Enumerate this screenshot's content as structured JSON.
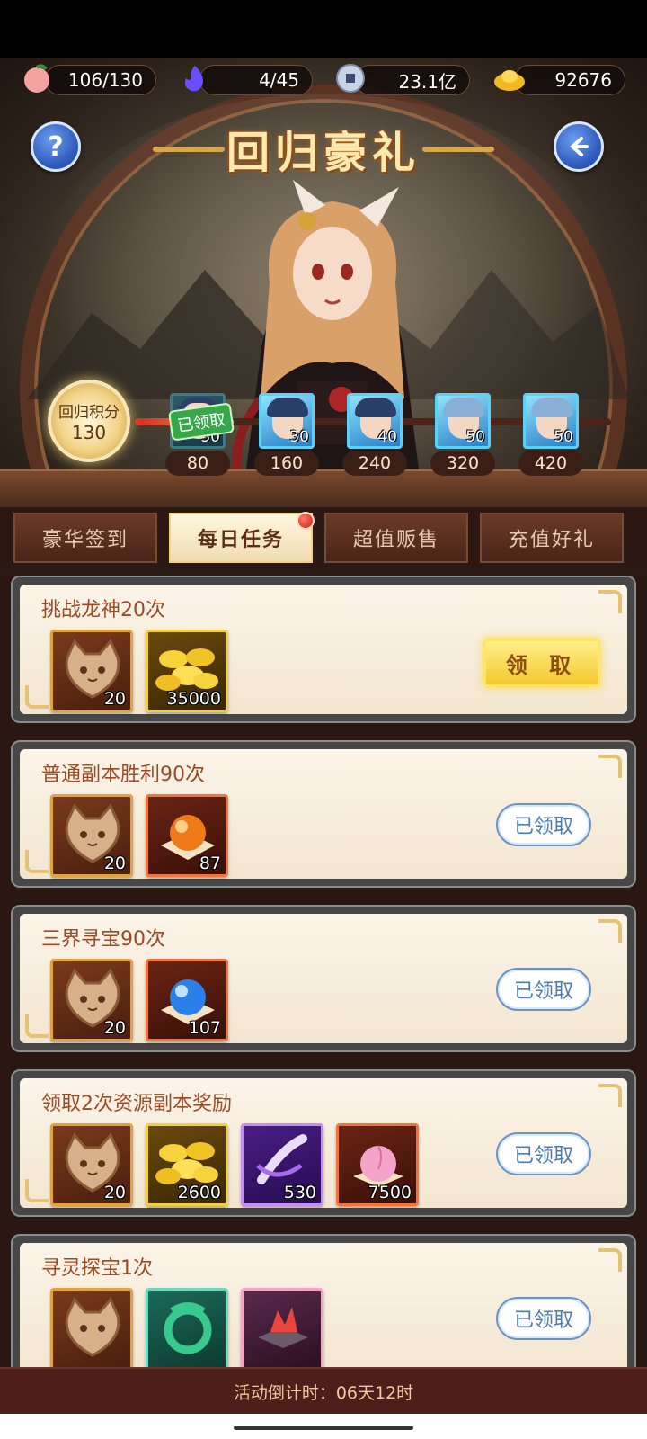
{
  "resources": {
    "stamina": "106/130",
    "spirit": "4/45",
    "coins": "23.1亿",
    "ingots": "92676"
  },
  "header": {
    "title": "回归豪礼"
  },
  "points": {
    "label": "回归积分",
    "value": "130"
  },
  "milestones": [
    {
      "value": "80",
      "count": "30",
      "claimed": true
    },
    {
      "value": "160",
      "count": "30",
      "claimed": false
    },
    {
      "value": "240",
      "count": "40",
      "claimed": false
    },
    {
      "value": "320",
      "count": "50",
      "claimed": false
    },
    {
      "value": "420",
      "count": "50",
      "claimed": false
    }
  ],
  "claimed_tag": "已领取",
  "tabs": [
    "豪华签到",
    "每日任务",
    "超值贩售",
    "充值好礼"
  ],
  "active_tab": "每日任务",
  "tasks": [
    {
      "title": "挑战龙神20次",
      "rewards": [
        {
          "icon": "cat-token-icon",
          "qty": "20"
        },
        {
          "icon": "gold-ingot-pile-icon",
          "qty": "35000"
        }
      ],
      "button": "领 取"
    },
    {
      "title": "普通副本胜利90次",
      "rewards": [
        {
          "icon": "cat-token-icon",
          "qty": "20"
        },
        {
          "icon": "orange-orb-icon",
          "qty": "87"
        }
      ],
      "button": "已领取"
    },
    {
      "title": "三界寻宝90次",
      "rewards": [
        {
          "icon": "cat-token-icon",
          "qty": "20"
        },
        {
          "icon": "blue-orb-icon",
          "qty": "107"
        }
      ],
      "button": "已领取"
    },
    {
      "title": "领取2次资源副本奖励",
      "rewards": [
        {
          "icon": "cat-token-icon",
          "qty": "20"
        },
        {
          "icon": "gold-ingot-pile-icon",
          "qty": "2600"
        },
        {
          "icon": "purple-scroll-icon",
          "qty": "530"
        },
        {
          "icon": "pink-peach-icon",
          "qty": "7500"
        }
      ],
      "button": "已领取"
    },
    {
      "title": "寻灵探宝1次",
      "rewards": [
        {
          "icon": "cat-token-icon",
          "qty": ""
        },
        {
          "icon": "jade-dragon-icon",
          "qty": ""
        },
        {
          "icon": "red-crystal-icon",
          "qty": ""
        }
      ],
      "button": "已领取"
    }
  ],
  "footer": {
    "countdown": "活动倒计时：06天12时"
  },
  "colors": {
    "accent_gold": "#f4c72e",
    "claimed_blue": "#4d7bb5",
    "title_brown": "#9c4a26"
  }
}
